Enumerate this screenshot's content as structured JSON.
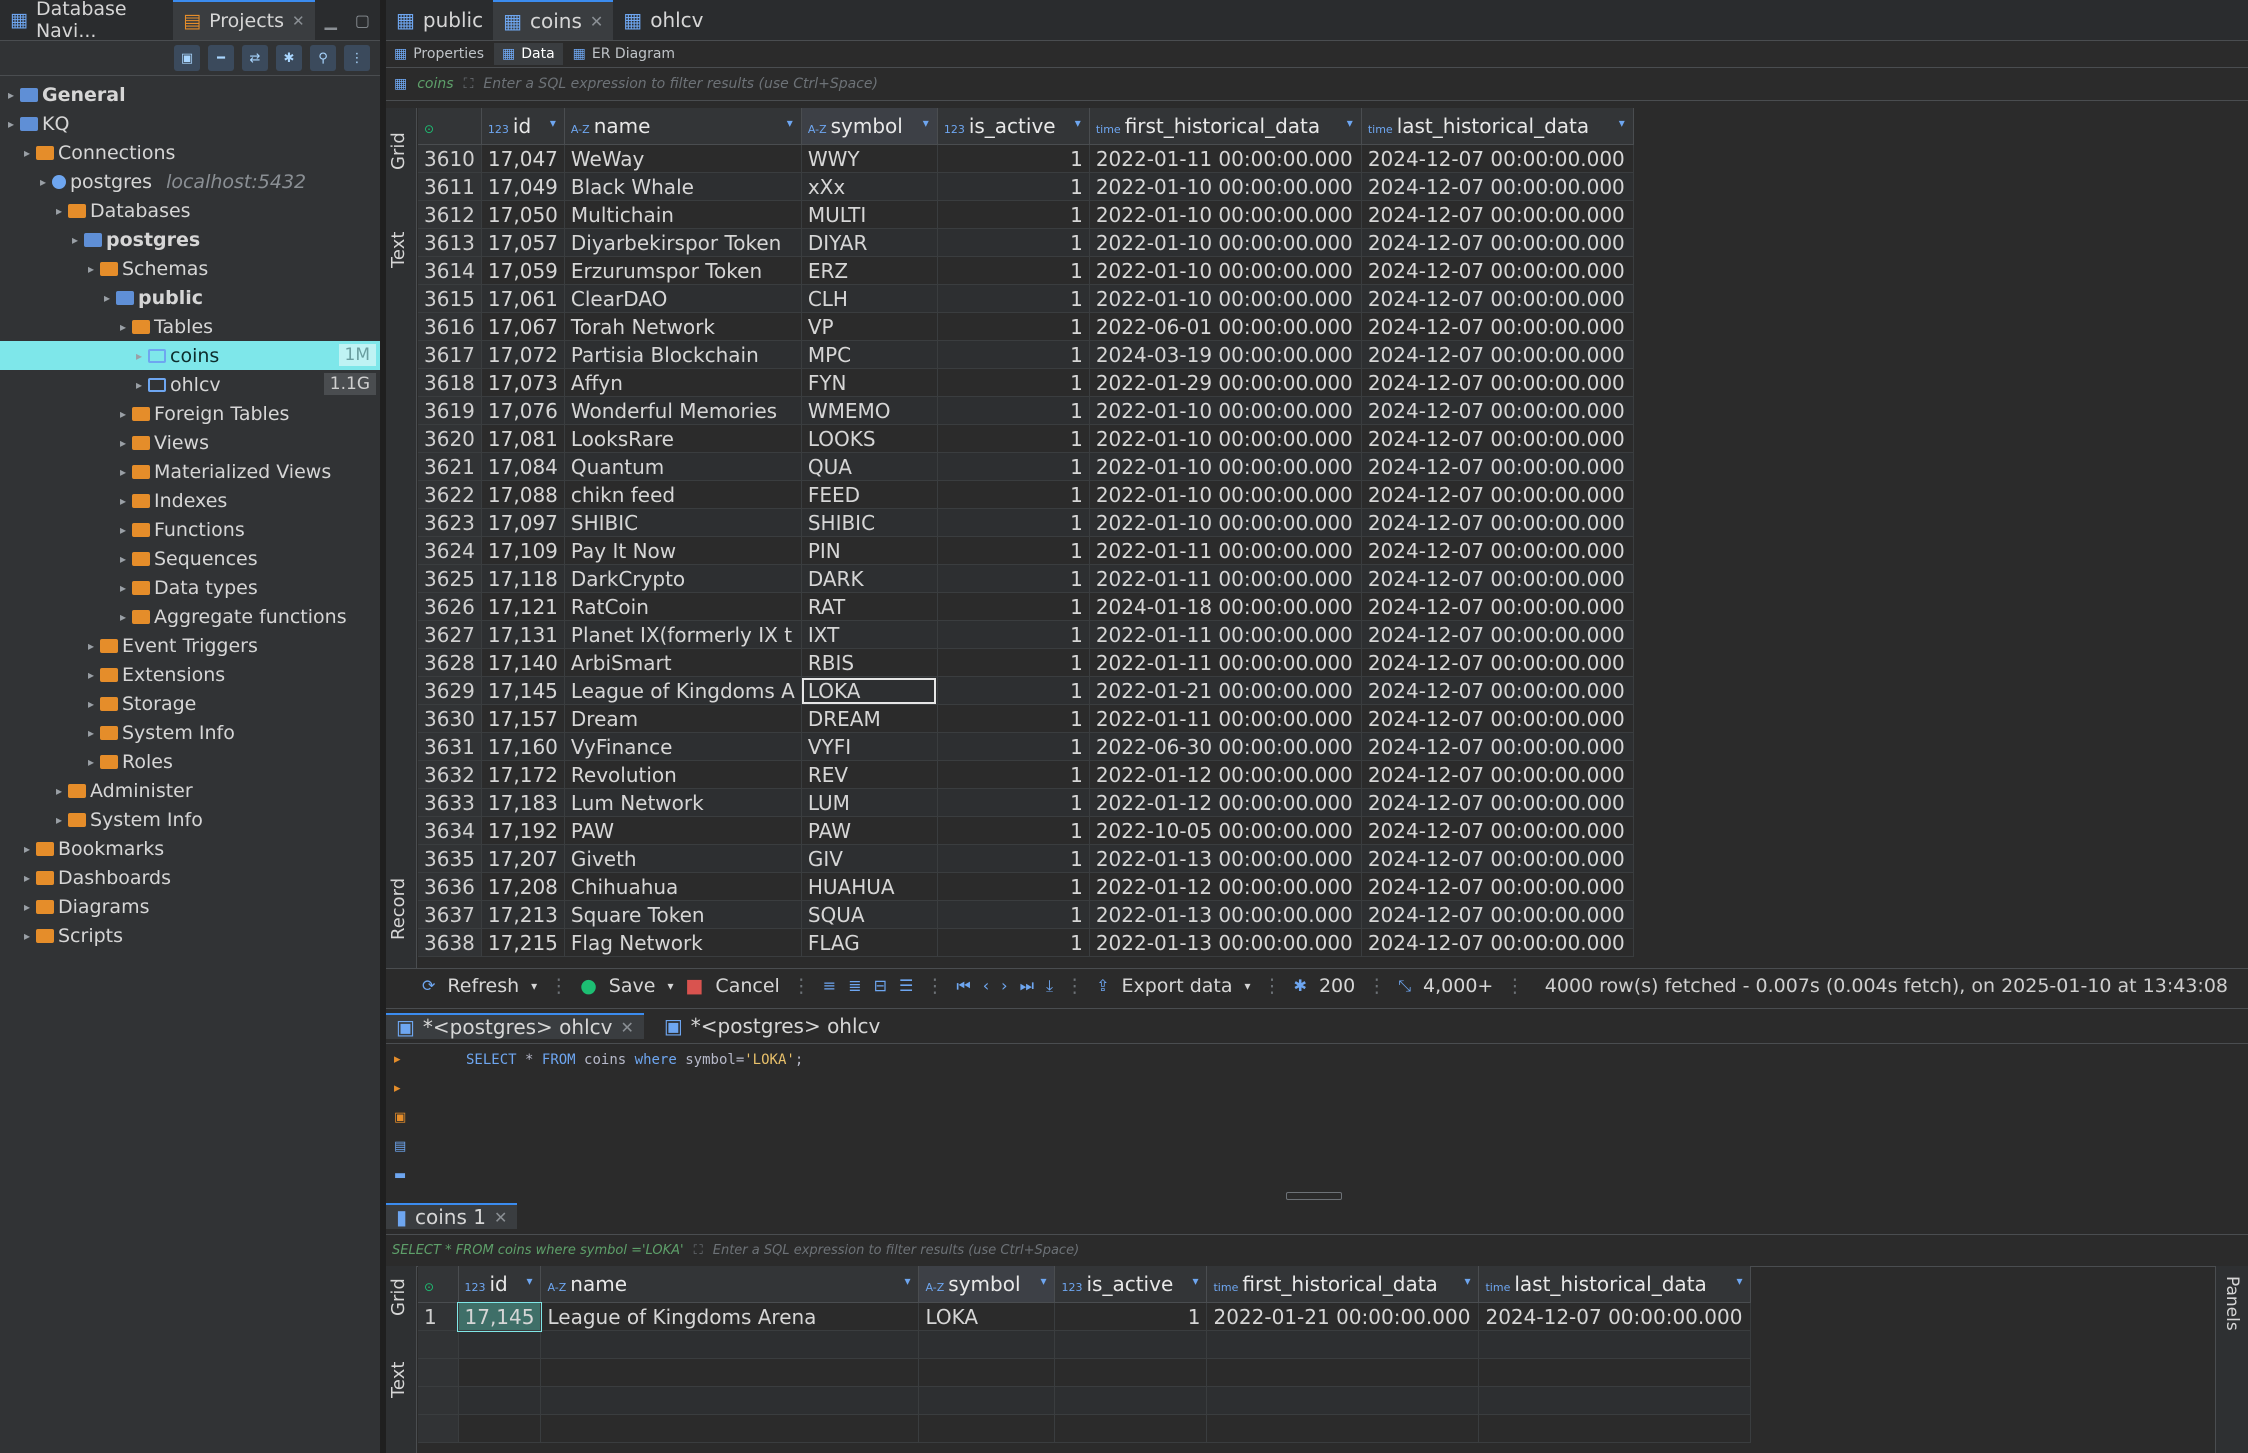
{
  "left_tabs": [
    {
      "label": "Database Navi..."
    },
    {
      "label": "Projects"
    }
  ],
  "tree": [
    {
      "indent": 0,
      "label": "General",
      "icon": "project",
      "bold": true
    },
    {
      "indent": 0,
      "label": "KQ",
      "icon": "project"
    },
    {
      "indent": 1,
      "label": "Connections",
      "icon": "folder"
    },
    {
      "indent": 2,
      "label": "postgres",
      "hint": "localhost:5432",
      "icon": "server"
    },
    {
      "indent": 3,
      "label": "Databases",
      "icon": "folder"
    },
    {
      "indent": 4,
      "label": "postgres",
      "icon": "db",
      "bold": true
    },
    {
      "indent": 5,
      "label": "Schemas",
      "icon": "folder"
    },
    {
      "indent": 6,
      "label": "public",
      "icon": "db",
      "bold": true
    },
    {
      "indent": 7,
      "label": "Tables",
      "icon": "folder"
    },
    {
      "indent": 8,
      "label": "coins",
      "icon": "table",
      "size": "1M",
      "selected": true
    },
    {
      "indent": 8,
      "label": "ohlcv",
      "icon": "table",
      "size": "1.1G"
    },
    {
      "indent": 7,
      "label": "Foreign Tables",
      "icon": "folder"
    },
    {
      "indent": 7,
      "label": "Views",
      "icon": "folder"
    },
    {
      "indent": 7,
      "label": "Materialized Views",
      "icon": "folder"
    },
    {
      "indent": 7,
      "label": "Indexes",
      "icon": "folder"
    },
    {
      "indent": 7,
      "label": "Functions",
      "icon": "folder"
    },
    {
      "indent": 7,
      "label": "Sequences",
      "icon": "folder"
    },
    {
      "indent": 7,
      "label": "Data types",
      "icon": "folder"
    },
    {
      "indent": 7,
      "label": "Aggregate functions",
      "icon": "folder"
    },
    {
      "indent": 5,
      "label": "Event Triggers",
      "icon": "folder"
    },
    {
      "indent": 5,
      "label": "Extensions",
      "icon": "folder"
    },
    {
      "indent": 5,
      "label": "Storage",
      "icon": "folder"
    },
    {
      "indent": 5,
      "label": "System Info",
      "icon": "folder"
    },
    {
      "indent": 5,
      "label": "Roles",
      "icon": "folder"
    },
    {
      "indent": 3,
      "label": "Administer",
      "icon": "folder"
    },
    {
      "indent": 3,
      "label": "System Info",
      "icon": "folder"
    },
    {
      "indent": 1,
      "label": "Bookmarks",
      "icon": "folder"
    },
    {
      "indent": 1,
      "label": "Dashboards",
      "icon": "folder"
    },
    {
      "indent": 1,
      "label": "Diagrams",
      "icon": "folder"
    },
    {
      "indent": 1,
      "label": "Scripts",
      "icon": "folder"
    }
  ],
  "editor_tabs": [
    {
      "label": "public"
    },
    {
      "label": "coins",
      "active": true,
      "closable": true
    },
    {
      "label": "ohlcv"
    }
  ],
  "sub_tabs": [
    {
      "label": "Properties"
    },
    {
      "label": "Data",
      "active": true
    },
    {
      "label": "ER Diagram"
    }
  ],
  "filter": {
    "table": "coins",
    "placeholder": "Enter a SQL expression to filter results (use Ctrl+Space)"
  },
  "vertical_tabs": {
    "grid": "Grid",
    "text": "Text",
    "record": "Record"
  },
  "columns": [
    {
      "label": "id",
      "type": "123"
    },
    {
      "label": "name",
      "type": "A-Z"
    },
    {
      "label": "symbol",
      "type": "A-Z"
    },
    {
      "label": "is_active",
      "type": "123"
    },
    {
      "label": "first_historical_data",
      "type": "time"
    },
    {
      "label": "last_historical_data",
      "type": "time"
    }
  ],
  "rows": [
    [
      "3610",
      "17,047",
      "WeWay",
      "WWY",
      "1",
      "2022-01-11 00:00:00.000",
      "2024-12-07 00:00:00.000"
    ],
    [
      "3611",
      "17,049",
      "Black Whale",
      "xXx",
      "1",
      "2022-01-10 00:00:00.000",
      "2024-12-07 00:00:00.000"
    ],
    [
      "3612",
      "17,050",
      "Multichain",
      "MULTI",
      "1",
      "2022-01-10 00:00:00.000",
      "2024-12-07 00:00:00.000"
    ],
    [
      "3613",
      "17,057",
      "Diyarbekirspor Token",
      "DIYAR",
      "1",
      "2022-01-10 00:00:00.000",
      "2024-12-07 00:00:00.000"
    ],
    [
      "3614",
      "17,059",
      "Erzurumspor Token",
      "ERZ",
      "1",
      "2022-01-10 00:00:00.000",
      "2024-12-07 00:00:00.000"
    ],
    [
      "3615",
      "17,061",
      "ClearDAO",
      "CLH",
      "1",
      "2022-01-10 00:00:00.000",
      "2024-12-07 00:00:00.000"
    ],
    [
      "3616",
      "17,067",
      "Torah Network",
      "VP",
      "1",
      "2022-06-01 00:00:00.000",
      "2024-12-07 00:00:00.000"
    ],
    [
      "3617",
      "17,072",
      "Partisia Blockchain",
      "MPC",
      "1",
      "2024-03-19 00:00:00.000",
      "2024-12-07 00:00:00.000"
    ],
    [
      "3618",
      "17,073",
      "Affyn",
      "FYN",
      "1",
      "2022-01-29 00:00:00.000",
      "2024-12-07 00:00:00.000"
    ],
    [
      "3619",
      "17,076",
      "Wonderful Memories",
      "WMEMO",
      "1",
      "2022-01-10 00:00:00.000",
      "2024-12-07 00:00:00.000"
    ],
    [
      "3620",
      "17,081",
      "LooksRare",
      "LOOKS",
      "1",
      "2022-01-10 00:00:00.000",
      "2024-12-07 00:00:00.000"
    ],
    [
      "3621",
      "17,084",
      "Quantum",
      "QUA",
      "1",
      "2022-01-10 00:00:00.000",
      "2024-12-07 00:00:00.000"
    ],
    [
      "3622",
      "17,088",
      "chikn feed",
      "FEED",
      "1",
      "2022-01-10 00:00:00.000",
      "2024-12-07 00:00:00.000"
    ],
    [
      "3623",
      "17,097",
      "SHIBIC",
      "SHIBIC",
      "1",
      "2022-01-10 00:00:00.000",
      "2024-12-07 00:00:00.000"
    ],
    [
      "3624",
      "17,109",
      "Pay It Now",
      "PIN",
      "1",
      "2022-01-11 00:00:00.000",
      "2024-12-07 00:00:00.000"
    ],
    [
      "3625",
      "17,118",
      "DarkCrypto",
      "DARK",
      "1",
      "2022-01-11 00:00:00.000",
      "2024-12-07 00:00:00.000"
    ],
    [
      "3626",
      "17,121",
      "RatCoin",
      "RAT",
      "1",
      "2024-01-18 00:00:00.000",
      "2024-12-07 00:00:00.000"
    ],
    [
      "3627",
      "17,131",
      "Planet IX(formerly IX t",
      "IXT",
      "1",
      "2022-01-11 00:00:00.000",
      "2024-12-07 00:00:00.000"
    ],
    [
      "3628",
      "17,140",
      "ArbiSmart",
      "RBIS",
      "1",
      "2022-01-11 00:00:00.000",
      "2024-12-07 00:00:00.000"
    ],
    [
      "3629",
      "17,145",
      "League of Kingdoms A",
      "LOKA",
      "1",
      "2022-01-21 00:00:00.000",
      "2024-12-07 00:00:00.000"
    ],
    [
      "3630",
      "17,157",
      "Dream",
      "DREAM",
      "1",
      "2022-01-11 00:00:00.000",
      "2024-12-07 00:00:00.000"
    ],
    [
      "3631",
      "17,160",
      "VyFinance",
      "VYFI",
      "1",
      "2022-06-30 00:00:00.000",
      "2024-12-07 00:00:00.000"
    ],
    [
      "3632",
      "17,172",
      "Revolution",
      "REV",
      "1",
      "2022-01-12 00:00:00.000",
      "2024-12-07 00:00:00.000"
    ],
    [
      "3633",
      "17,183",
      "Lum Network",
      "LUM",
      "1",
      "2022-01-12 00:00:00.000",
      "2024-12-07 00:00:00.000"
    ],
    [
      "3634",
      "17,192",
      "PAW",
      "PAW",
      "1",
      "2022-10-05 00:00:00.000",
      "2024-12-07 00:00:00.000"
    ],
    [
      "3635",
      "17,207",
      "Giveth",
      "GIV",
      "1",
      "2022-01-13 00:00:00.000",
      "2024-12-07 00:00:00.000"
    ],
    [
      "3636",
      "17,208",
      "Chihuahua",
      "HUAHUA",
      "1",
      "2022-01-12 00:00:00.000",
      "2024-12-07 00:00:00.000"
    ],
    [
      "3637",
      "17,213",
      "Square Token",
      "SQUA",
      "1",
      "2022-01-13 00:00:00.000",
      "2024-12-07 00:00:00.000"
    ],
    [
      "3638",
      "17,215",
      "Flag Network",
      "FLAG",
      "1",
      "2022-01-13 00:00:00.000",
      "2024-12-07 00:00:00.000"
    ]
  ],
  "status": {
    "refresh": "Refresh",
    "save": "Save",
    "cancel": "Cancel",
    "export": "Export data",
    "fetch_size": "200",
    "count": "4,000+",
    "message": "4000 row(s) fetched - 0.007s (0.004s fetch), on 2025-01-10 at 13:43:08"
  },
  "sql_tabs": [
    {
      "label": "*<postgres> ohlcv",
      "active": true
    },
    {
      "label": "*<postgres> ohlcv"
    }
  ],
  "sql": {
    "kw1": "SELECT",
    "star": "*",
    "kw2": "FROM",
    "tbl": "coins",
    "kw3": "where",
    "col": "symbol",
    "op": "=",
    "val": "'LOKA'",
    "end": ";"
  },
  "results_tab": {
    "label": "coins 1"
  },
  "results_filter": {
    "query": "SELECT * FROM coins where symbol ='LOKA'",
    "placeholder": "Enter a SQL expression to filter results (use Ctrl+Space)"
  },
  "result_rows": [
    [
      "1",
      "17,145",
      "League of Kingdoms Arena",
      "LOKA",
      "1",
      "2022-01-21 00:00:00.000",
      "2024-12-07 00:00:00.000"
    ]
  ],
  "panels_label": "Panels"
}
